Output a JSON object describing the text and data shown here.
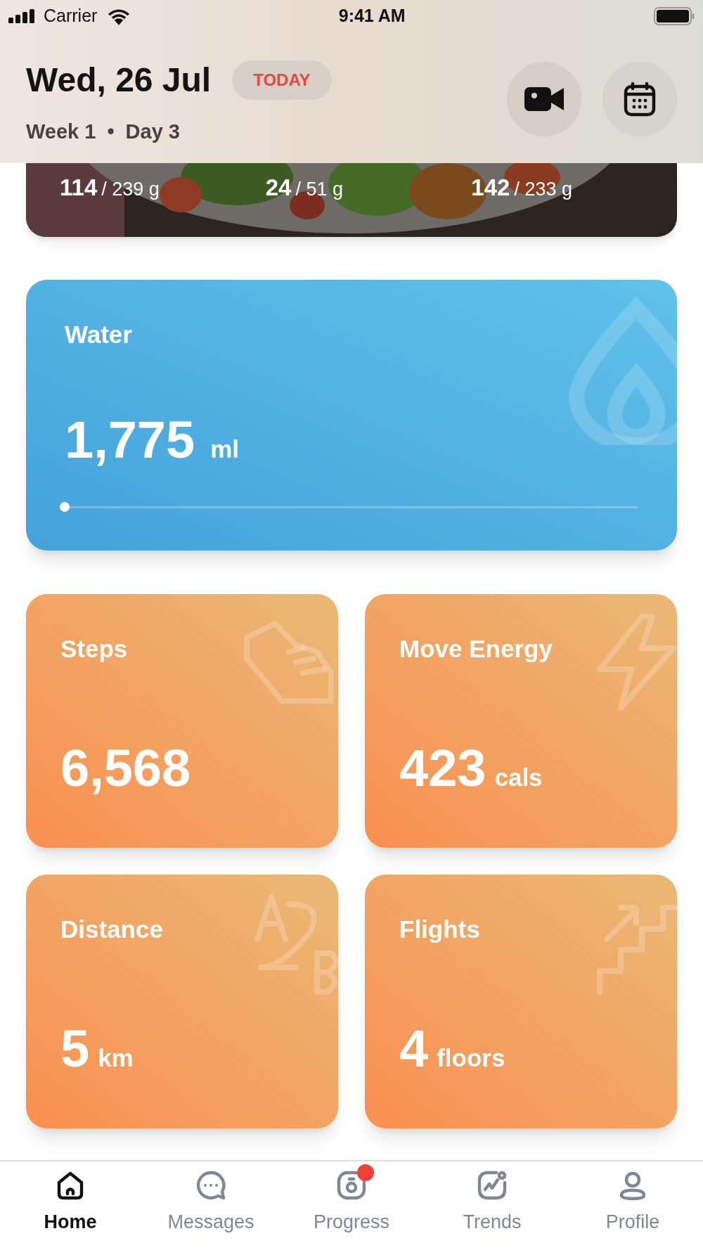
{
  "status_bar": {
    "carrier": "Carrier",
    "time": "9:41 AM"
  },
  "header": {
    "date": "Wed, 26 Jul",
    "badge": "TODAY",
    "week": "Week **1**",
    "separator": "•",
    "day": "Day **3**"
  },
  "macros": [
    {
      "value": "114",
      "target": "/ 239 g"
    },
    {
      "value": "24",
      "target": "/ 51 g"
    },
    {
      "value": "142",
      "target": "/ 233 g"
    }
  ],
  "water": {
    "title": "Water",
    "value": "1,775",
    "unit": "ml",
    "level": 0
  },
  "metrics": [
    {
      "kind": "steps",
      "title": "Steps",
      "value": "6,568"
    },
    {
      "kind": "energy",
      "title": "Move Energy",
      "value": "423",
      "unit": "cals"
    },
    {
      "kind": "distance",
      "title": "Distance",
      "value": "5",
      "unit": "km"
    },
    {
      "kind": "flights",
      "title": "Flights",
      "value": "4",
      "unit": "floors"
    }
  ],
  "tabs": [
    {
      "kind": "home",
      "label": "Home",
      "selected": true,
      "badge": false
    },
    {
      "kind": "messages",
      "label": "Messages",
      "selected": false,
      "badge": false
    },
    {
      "kind": "progress",
      "label": "Progress",
      "selected": false,
      "badge": true
    },
    {
      "kind": "trends",
      "label": "Trends",
      "selected": false,
      "badge": false
    },
    {
      "kind": "profile",
      "label": "Profile",
      "selected": false,
      "badge": false
    }
  ]
}
